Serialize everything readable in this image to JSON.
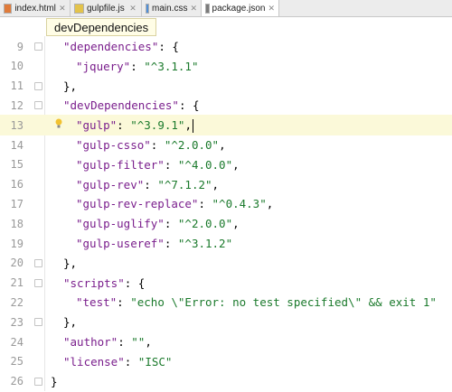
{
  "tabs": [
    {
      "name": "index.html",
      "icon": "html-file-icon",
      "color": "#e07b3a",
      "active": false
    },
    {
      "name": "gulpfile.js",
      "icon": "js-file-icon",
      "color": "#e3c34b",
      "active": false
    },
    {
      "name": "main.css",
      "icon": "css-file-icon",
      "color": "#4f8fd8",
      "active": false
    },
    {
      "name": "package.json",
      "icon": "json-file-icon",
      "color": "#7a7a7a",
      "active": true
    }
  ],
  "close_glyph": "✕",
  "breadcrumb_popup": "devDependencies",
  "colors": {
    "key": "#7a1e8c",
    "string": "#1b7a2c",
    "current_line": "#fbf9d9",
    "line_number": "#999999"
  },
  "lines": [
    {
      "n": "9",
      "indent": 1,
      "key": "\"dependencies\"",
      "rest": ": {",
      "value": "",
      "tail": ""
    },
    {
      "n": "10",
      "indent": 2,
      "key": "\"jquery\"",
      "rest": ": ",
      "value": "\"^3.1.1\"",
      "tail": ""
    },
    {
      "n": "11",
      "indent": 1,
      "key": "",
      "rest": "},",
      "value": "",
      "tail": ""
    },
    {
      "n": "12",
      "indent": 1,
      "key": "\"devDependencies\"",
      "rest": ": {",
      "value": "",
      "tail": ""
    },
    {
      "n": "13",
      "indent": 2,
      "key": "\"gulp\"",
      "rest": ": ",
      "value": "\"^3.9.1\"",
      "tail": ","
    },
    {
      "n": "14",
      "indent": 2,
      "key": "\"gulp-csso\"",
      "rest": ": ",
      "value": "\"^2.0.0\"",
      "tail": ","
    },
    {
      "n": "15",
      "indent": 2,
      "key": "\"gulp-filter\"",
      "rest": ": ",
      "value": "\"^4.0.0\"",
      "tail": ","
    },
    {
      "n": "16",
      "indent": 2,
      "key": "\"gulp-rev\"",
      "rest": ": ",
      "value": "\"^7.1.2\"",
      "tail": ","
    },
    {
      "n": "17",
      "indent": 2,
      "key": "\"gulp-rev-replace\"",
      "rest": ": ",
      "value": "\"^0.4.3\"",
      "tail": ","
    },
    {
      "n": "18",
      "indent": 2,
      "key": "\"gulp-uglify\"",
      "rest": ": ",
      "value": "\"^2.0.0\"",
      "tail": ","
    },
    {
      "n": "19",
      "indent": 2,
      "key": "\"gulp-useref\"",
      "rest": ": ",
      "value": "\"^3.1.2\"",
      "tail": ""
    },
    {
      "n": "20",
      "indent": 1,
      "key": "",
      "rest": "},",
      "value": "",
      "tail": ""
    },
    {
      "n": "21",
      "indent": 1,
      "key": "\"scripts\"",
      "rest": ": {",
      "value": "",
      "tail": ""
    },
    {
      "n": "22",
      "indent": 2,
      "key": "\"test\"",
      "rest": ": ",
      "value": "\"echo \\\"Error: no test specified\\\" && exit 1\"",
      "tail": ""
    },
    {
      "n": "23",
      "indent": 1,
      "key": "",
      "rest": "},",
      "value": "",
      "tail": ""
    },
    {
      "n": "24",
      "indent": 1,
      "key": "\"author\"",
      "rest": ": ",
      "value": "\"\"",
      "tail": ","
    },
    {
      "n": "25",
      "indent": 1,
      "key": "\"license\"",
      "rest": ": ",
      "value": "\"ISC\"",
      "tail": ""
    },
    {
      "n": "26",
      "indent": 0,
      "key": "",
      "rest": "}",
      "value": "",
      "tail": ""
    }
  ],
  "current_line": "13"
}
